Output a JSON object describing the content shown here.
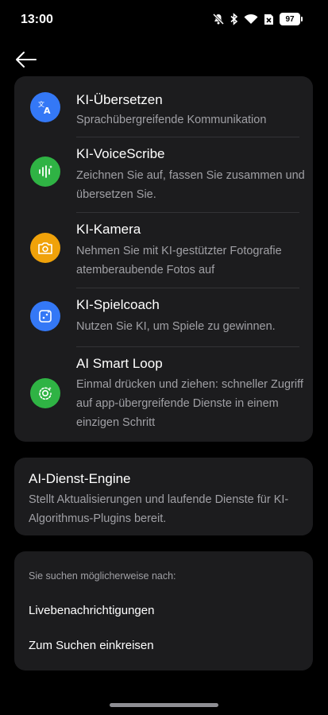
{
  "status_bar": {
    "time": "13:00",
    "battery": "97",
    "icons": [
      "mute-icon",
      "bluetooth-icon",
      "wifi-icon",
      "sim-x-icon",
      "battery-icon"
    ]
  },
  "nav": {
    "back_icon": "arrow-left-icon"
  },
  "ai_features": [
    {
      "title": "KI-Übersetzen",
      "description": "Sprachübergreifende Kommunikation",
      "icon": "translate-icon",
      "color": "#3478f6"
    },
    {
      "title": "KI-VoiceScribe",
      "description": "Zeichnen Sie auf, fassen Sie zusammen und übersetzen Sie.",
      "icon": "voice-wave-icon",
      "color": "#2fb344"
    },
    {
      "title": "KI-Kamera",
      "description": "Nehmen Sie mit KI-gestützter Fotografie atemberaubende Fotos auf",
      "icon": "camera-icon",
      "color": "#f0a20a"
    },
    {
      "title": "KI-Spielcoach",
      "description": "Nutzen Sie KI, um Spiele zu gewinnen.",
      "icon": "game-coach-icon",
      "color": "#3478f6"
    },
    {
      "title": "AI Smart Loop",
      "description": "Einmal drücken und ziehen: schneller Zugriff auf app-übergreifende Dienste in einem einzigen Schritt",
      "icon": "smart-loop-icon",
      "color": "#2fb344"
    }
  ],
  "engine": {
    "title": "AI-Dienst-Engine",
    "description": "Stellt Aktualisierungen und laufende Dienste für KI-Algorithmus-Plugins bereit."
  },
  "suggestions": {
    "header": "Sie suchen möglicherweise nach:",
    "items": [
      "Livebenachrichtigungen",
      "Zum Suchen einkreisen"
    ]
  }
}
